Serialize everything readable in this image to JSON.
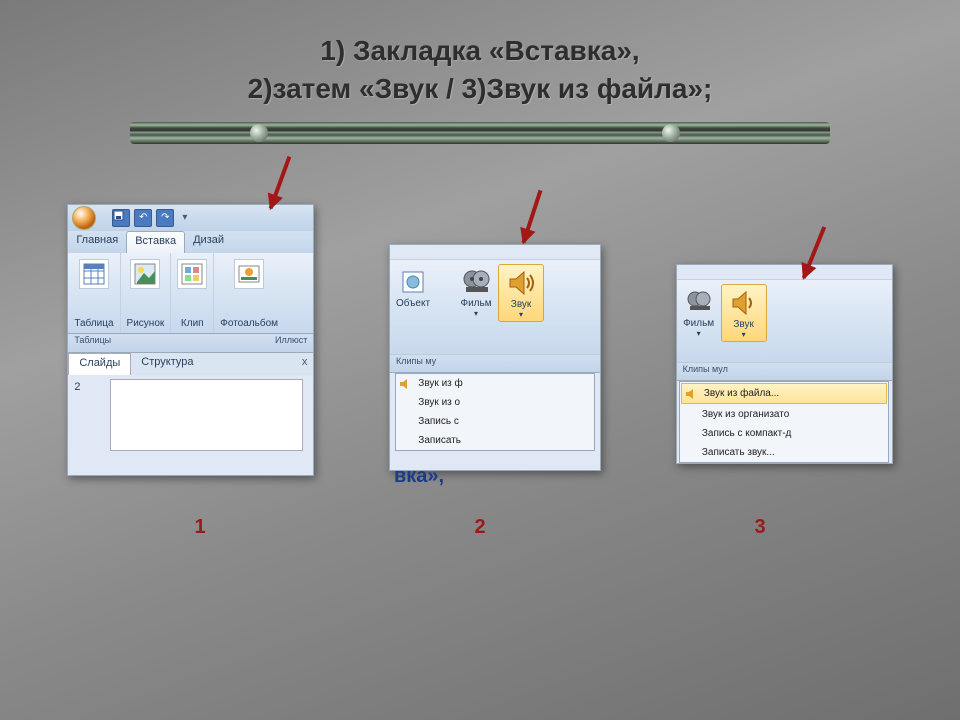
{
  "title_line1": "1) Закладка «Вставка»,",
  "title_line2": "2)затем  «Звук / 3)Звук из файла»;",
  "shot1": {
    "qat": {
      "save": "💾",
      "undo": "↶",
      "redo": "↷"
    },
    "tabs": [
      "Главная",
      "Вставка",
      "Дизай"
    ],
    "active_tab": "Вставка",
    "ribbon": {
      "table": "Таблица",
      "picture": "Рисунок",
      "clip": "Клип",
      "album": "Фотоальбом"
    },
    "groups": {
      "g1": "Таблицы",
      "g2": "Иллюст"
    },
    "pane_tabs": [
      "Слайды",
      "Структура"
    ],
    "active_pane": "Слайды",
    "slide_num": "2"
  },
  "shot2": {
    "ribbon": {
      "object": "Объект",
      "film": "Фильм",
      "sound": "Звук"
    },
    "group": "Клипы му",
    "dropdown": [
      "Звук из ф",
      "Звук из о",
      "Запись с",
      "Записать"
    ],
    "frag": "вка»,"
  },
  "shot3": {
    "ribbon": {
      "film": "Фильм",
      "sound": "Звук"
    },
    "group": "Клипы мул",
    "dropdown": [
      "Звук из файла...",
      "Звук из организато",
      "Запись с компакт-д",
      "Записать звук..."
    ],
    "selected": 0,
    "frag1": "»,",
    "frag2": "файла»;"
  },
  "labels": {
    "n1": "1",
    "n2": "2",
    "n3": "3"
  }
}
